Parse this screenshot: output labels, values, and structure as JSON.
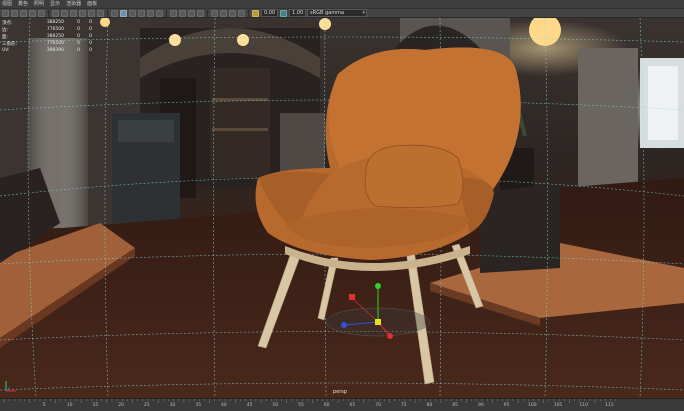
{
  "menu": {
    "items": [
      "视图",
      "着色",
      "照明",
      "显示",
      "渲染器",
      "面板"
    ]
  },
  "toolbar": {
    "value1": "0.00",
    "value2": "1.00",
    "colorspace": "sRGB gamma"
  },
  "hud": {
    "rows": [
      {
        "label": "顶点:",
        "v1": "388250",
        "v2": "0",
        "v3": "0"
      },
      {
        "label": "边:",
        "v1": "776500",
        "v2": "0",
        "v3": "0"
      },
      {
        "label": "面:",
        "v1": "388250",
        "v2": "0",
        "v3": "0"
      },
      {
        "label": "三角形:",
        "v1": "776500",
        "v2": "0",
        "v3": "0"
      },
      {
        "label": "UV:",
        "v1": "398390",
        "v2": "0",
        "v3": "0"
      }
    ]
  },
  "viewport": {
    "camera_label": "persp"
  },
  "timeline": {
    "ticks": [
      "5",
      "10",
      "15",
      "20",
      "25",
      "30",
      "35",
      "40",
      "45",
      "50",
      "55",
      "60",
      "65",
      "70",
      "75",
      "80",
      "85",
      "90",
      "95",
      "100",
      "105",
      "110",
      "115"
    ]
  },
  "colors": {
    "grid": "#7fd9d0",
    "manip_x": "#e03030",
    "manip_y": "#30d030",
    "manip_z": "#3050e0",
    "manip_center": "#e8e020",
    "chair_fabric": "#b86a2e",
    "chair_legs": "#d8c6a4"
  }
}
